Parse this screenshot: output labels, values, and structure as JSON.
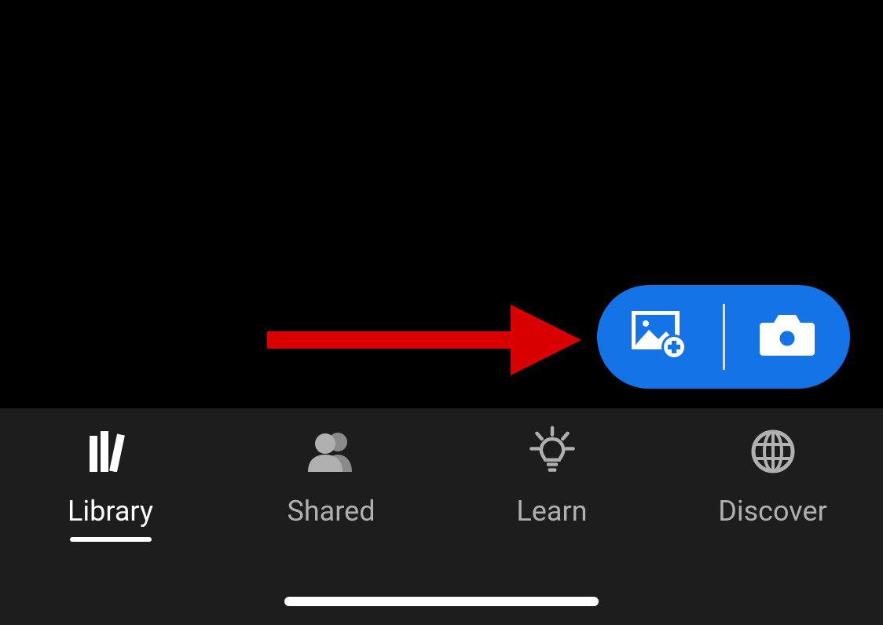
{
  "fab": {
    "add_photo_icon": "image-add",
    "camera_icon": "camera"
  },
  "tabs": [
    {
      "label": "Library",
      "icon": "books",
      "active": true
    },
    {
      "label": "Shared",
      "icon": "people",
      "active": false
    },
    {
      "label": "Learn",
      "icon": "bulb",
      "active": false
    },
    {
      "label": "Discover",
      "icon": "globe",
      "active": false
    }
  ],
  "annotation": {
    "type": "arrow",
    "color": "#D80000"
  }
}
